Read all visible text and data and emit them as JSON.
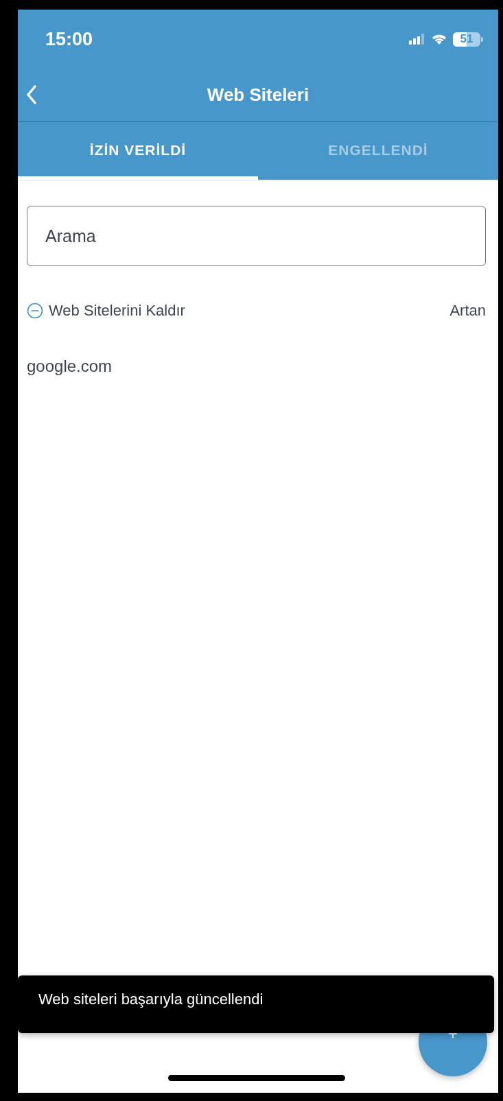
{
  "status_bar": {
    "time": "15:00",
    "battery": "51"
  },
  "header": {
    "title": "Web Siteleri"
  },
  "tabs": [
    {
      "label": "İZİN VERİLDİ",
      "selected": true
    },
    {
      "label": "ENGELLENDİ",
      "selected": false
    }
  ],
  "search": {
    "placeholder": "Arama"
  },
  "actions": {
    "remove": "Web Sitelerini Kaldır",
    "sort": "Artan"
  },
  "websites": [
    "google.com"
  ],
  "toast": "Web siteleri başarıyla güncellendi",
  "fab": "+"
}
